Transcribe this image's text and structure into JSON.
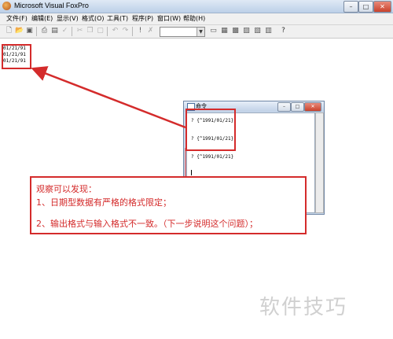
{
  "window": {
    "title": "Microsoft Visual FoxPro",
    "minimize": "–",
    "maximize": "□",
    "close": "✕"
  },
  "menu": [
    {
      "label": "文件(F)"
    },
    {
      "label": "编辑(E)"
    },
    {
      "label": "显示(V)"
    },
    {
      "label": "格式(O)"
    },
    {
      "label": "工具(T)"
    },
    {
      "label": "程序(P)"
    },
    {
      "label": "窗口(W)"
    },
    {
      "label": "帮助(H)"
    }
  ],
  "toolbar": {
    "icons": [
      "new-file-icon",
      "open-icon",
      "save-icon",
      "print-icon",
      "print-preview-icon",
      "spell-check-icon",
      "cut-icon",
      "copy-icon",
      "paste-icon",
      "undo-icon",
      "redo-icon",
      "run-icon",
      "modify-icon"
    ],
    "right_icons": [
      "command-window-icon",
      "view-window-icon",
      "form-wizard-icon",
      "report-wizard-icon",
      "auto-form-icon",
      "auto-report-icon",
      "help-icon"
    ],
    "combo_value": ""
  },
  "output": {
    "lines": [
      "01/21/91",
      "01/21/91",
      "01/21/91"
    ]
  },
  "command_window": {
    "title": "命令",
    "lines": [
      "? {^1991/01/21}",
      "? {^1991/01/21}",
      "? {^1991/01/21}"
    ]
  },
  "annotation": {
    "line1": "观察可以发现：",
    "line2": "1、日期型数据有严格的格式限定；",
    "line3": "2、输出格式与输入格式不一致。（下一步说明这个问题）；"
  },
  "watermark": "软件技巧",
  "colors": {
    "annotation_red": "#d42b2b",
    "titlebar": "#bcd0e8"
  }
}
